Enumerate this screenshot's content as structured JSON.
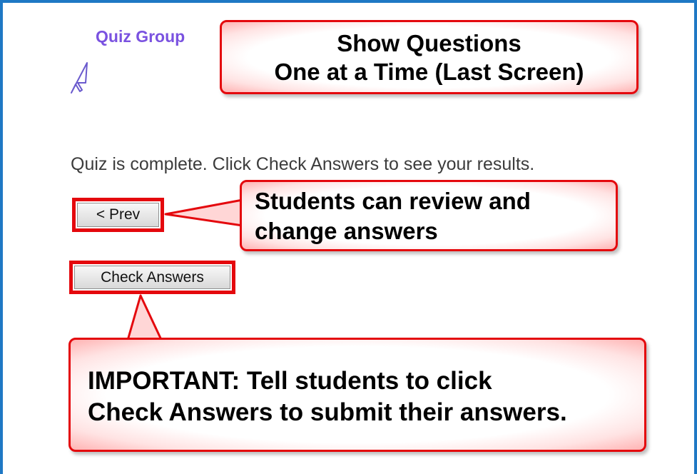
{
  "quiz_group_label": "Quiz Group",
  "callouts": {
    "title": {
      "line1": "Show Questions",
      "line2": "One at a Time (Last Screen)"
    },
    "review": {
      "line1": "Students can review and",
      "line2": "change answers"
    },
    "important": {
      "line1": "IMPORTANT: Tell students to click",
      "line2": "Check Answers to submit their answers."
    }
  },
  "status_text": "Quiz is complete. Click Check Answers to see your results.",
  "buttons": {
    "prev_label": "<  Prev",
    "check_label": "Check Answers"
  },
  "icons": {
    "pointer": "cursor-arrow-icon"
  },
  "colors": {
    "frame_border": "#1f78c4",
    "quiz_group": "#7a52e0",
    "callout_border": "#e4080d",
    "highlight_border": "#e4080d"
  }
}
